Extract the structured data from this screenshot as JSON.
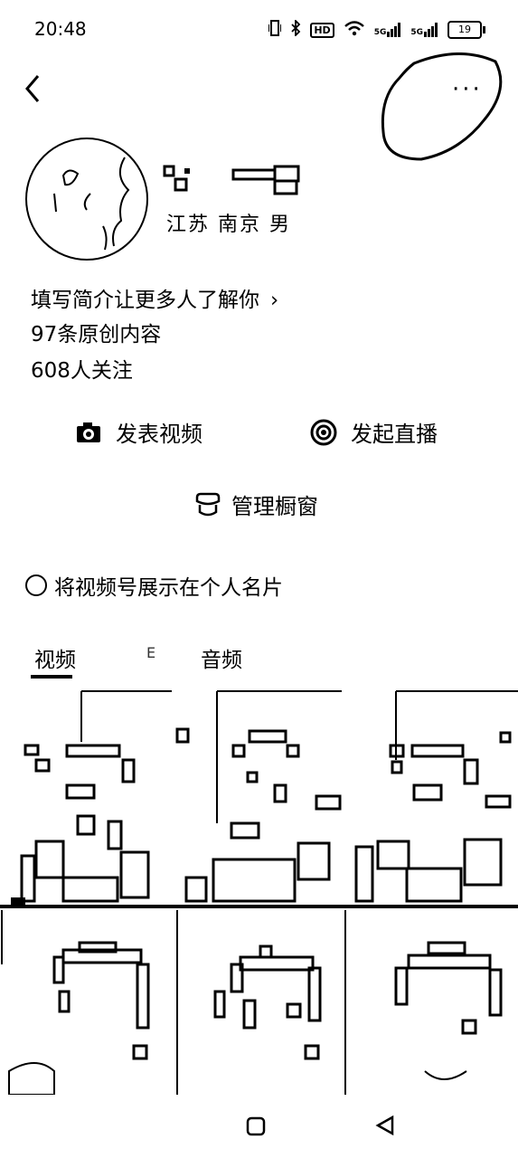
{
  "status_bar": {
    "time": "20:48",
    "battery": "19",
    "icons": [
      "vibrate-icon",
      "bluetooth-icon",
      "hd-icon",
      "wifi-icon",
      "signal-5g-icon",
      "signal-5g-icon",
      "battery-icon"
    ],
    "network_label_1": "5G",
    "network_label_2": "5G",
    "hd_label": "HD"
  },
  "profile": {
    "location": "江苏 南京 男",
    "bio_prompt": "填写简介让更多人了解你",
    "bio_chevron": "›",
    "original_content": "97条原创内容",
    "followers": "608人关注"
  },
  "actions": {
    "publish_video": "发表视频",
    "start_live": "发起直播",
    "manage_window": "管理橱窗"
  },
  "show_in_card": "将视频号展示在个人名片",
  "tabs": {
    "video": "视频",
    "middle": "E",
    "audio": "音频"
  },
  "icons": {
    "back": "back-icon",
    "more": "more-icon",
    "camera": "camera-icon",
    "live": "live-icon",
    "shop": "shop-window-icon",
    "home": "home-icon",
    "nav_back": "nav-back-icon"
  },
  "more_dots": "···",
  "grid_tiles_count": 6
}
